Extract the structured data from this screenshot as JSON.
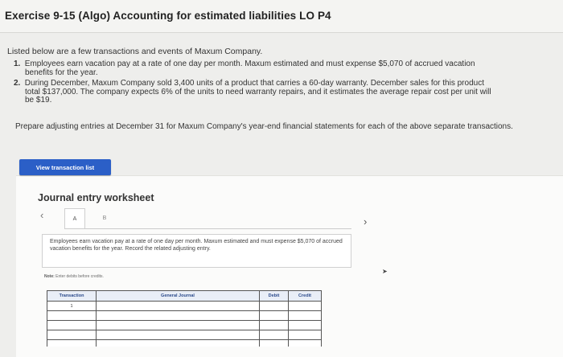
{
  "header": {
    "title": "Exercise 9-15 (Algo) Accounting for estimated liabilities LO P4"
  },
  "intro": "Listed below are a few transactions and events of Maxum Company.",
  "transactions": [
    {
      "num": "1.",
      "line1": "Employees earn vacation pay at a rate of one day per month. Maxum estimated and must expense $5,070 of accrued vacation",
      "line2": "benefits for the year."
    },
    {
      "num": "2.",
      "line1": "During December, Maxum Company sold 3,400 units of a product that carries a 60-day warranty. December sales for this product",
      "line2": "total $137,000. The company expects 6% of the units to need warranty repairs, and it estimates the average repair cost per unit will",
      "line3": "be $19."
    }
  ],
  "prompt": "Prepare adjusting entries at December 31 for Maxum Company's year-end financial statements for each of the above separate transactions.",
  "view_button": "View transaction list",
  "worksheet": {
    "title": "Journal entry worksheet",
    "tabs": [
      "A",
      "B"
    ],
    "description": "Employees earn vacation pay at a rate of one day per month. Maxum estimated and must expense $5,070 of accrued vacation benefits for the year. Record the related adjusting entry.",
    "note_label": "Note:",
    "note_text": "Enter debits before credits.",
    "columns": [
      "Transaction",
      "General Journal",
      "Debit",
      "Credit"
    ],
    "rows": [
      {
        "transaction": "1"
      },
      {
        "transaction": ""
      },
      {
        "transaction": ""
      },
      {
        "transaction": ""
      },
      {
        "transaction": ""
      }
    ]
  },
  "icons": {
    "prev": "chevron-left-icon",
    "next": "chevron-right-icon"
  }
}
